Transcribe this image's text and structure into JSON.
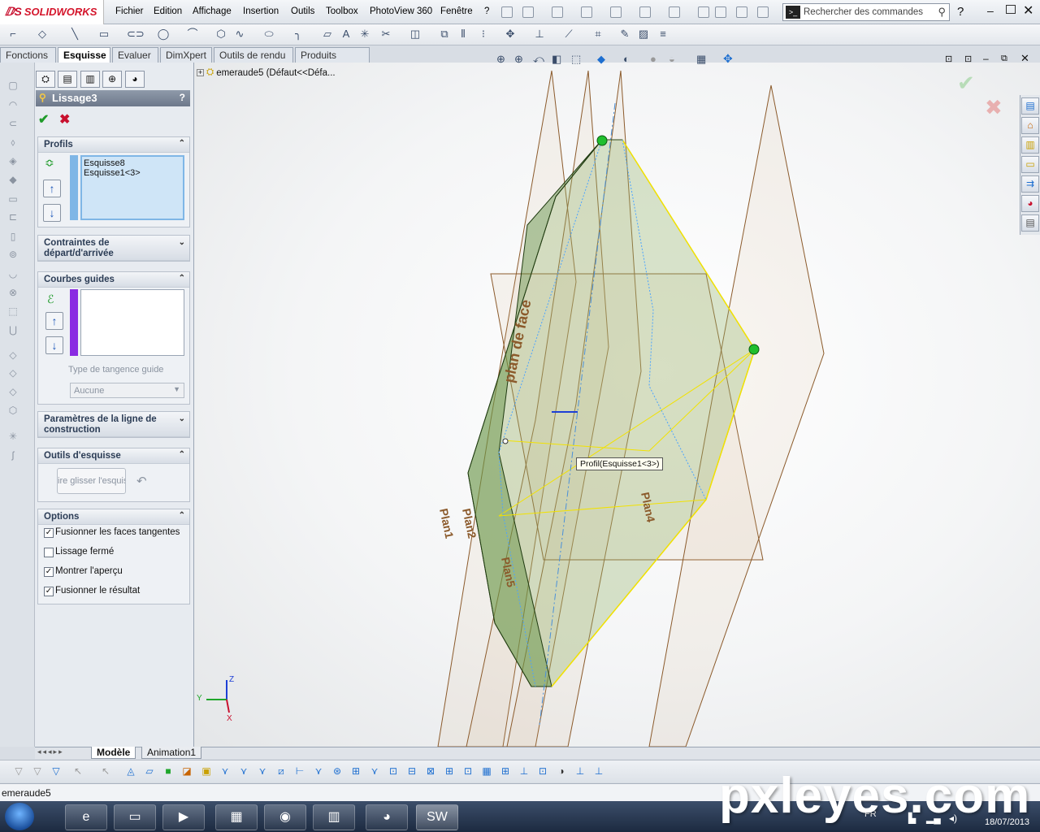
{
  "app": {
    "logo_text": "SOLIDWORKS"
  },
  "menu": [
    "Fichier",
    "Edition",
    "Affichage",
    "Insertion",
    "Outils",
    "Toolbox",
    "PhotoView 360",
    "Fenêtre",
    "?"
  ],
  "search": {
    "placeholder": "Rechercher des commandes"
  },
  "tabs": [
    {
      "label": "Fonctions",
      "active": false
    },
    {
      "label": "Esquisse",
      "active": true
    },
    {
      "label": "Evaluer",
      "active": false
    },
    {
      "label": "DimXpert",
      "active": false
    },
    {
      "label": "Outils de rendu",
      "active": false
    },
    {
      "label": "Produits Office",
      "active": false
    }
  ],
  "property_manager": {
    "title": "Lissage3",
    "help": "?",
    "profils": {
      "header": "Profils",
      "items": [
        "Esquisse8",
        "Esquisse1<3>"
      ]
    },
    "contraintes": {
      "header": "Contraintes de départ/d'arrivée"
    },
    "courbes_guides": {
      "header": "Courbes guides",
      "tangence_label": "Type de tangence guide",
      "tangence_value": "Aucune"
    },
    "parametres": {
      "header": "Paramètres de la ligne de construction"
    },
    "outils": {
      "header": "Outils d'esquisse",
      "drag_button": "ire glisser l'esquis"
    },
    "options": {
      "header": "Options",
      "items": [
        {
          "label": "Fusionner les faces tangentes",
          "checked": true
        },
        {
          "label": "Lissage fermé",
          "checked": false
        },
        {
          "label": "Montrer l'aperçu",
          "checked": true
        },
        {
          "label": "Fusionner le résultat",
          "checked": true
        }
      ]
    }
  },
  "tree": {
    "item": "emeraude5  (Défaut<<Défa..."
  },
  "viewport": {
    "tooltip": "Profil(Esquisse1<3>)",
    "plane_labels": [
      "plan de face",
      "Plan1",
      "Plan2",
      "Plan5",
      "Plan4",
      "Plan3"
    ],
    "triad": {
      "x": "X",
      "y": "Y",
      "z": "Z"
    }
  },
  "bottom_tabs": [
    "Modèle",
    "Animation1"
  ],
  "status": {
    "text": "emeraude5"
  },
  "taskbar": {
    "lang": "FR",
    "time": "",
    "date": "18/07/2013"
  },
  "watermark": "pxleyes.com",
  "colors": {
    "accent": "#c8102e",
    "selection": "#7fb6e6",
    "preview_green": "#8fb36a",
    "plane": "#8b5a2b"
  }
}
